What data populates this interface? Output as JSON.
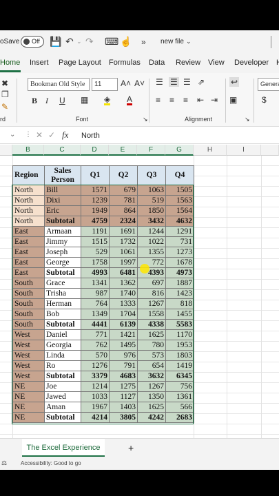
{
  "titlebar": {
    "autosave": "oSave",
    "toggle": "Off",
    "filename": "new file"
  },
  "tabs": [
    "Home",
    "Insert",
    "Page Layout",
    "Formulas",
    "Data",
    "Review",
    "View",
    "Developer",
    "H"
  ],
  "ribbon": {
    "font_name": "Bookman Old Style",
    "font_size": "11",
    "number_format": "General",
    "group_font": "Font",
    "group_alignment": "Alignment",
    "group_clip": "rd",
    "dollar": "$"
  },
  "formula": {
    "cell_value": "North"
  },
  "columns": [
    "B",
    "C",
    "D",
    "E",
    "F",
    "G",
    "H",
    "I"
  ],
  "table": {
    "headers": [
      "Region",
      "Sales Person",
      "Q1",
      "Q2",
      "Q3",
      "Q4"
    ],
    "rows": [
      [
        "North",
        "Bill",
        "1571",
        "679",
        "1063",
        "1505"
      ],
      [
        "North",
        "Dixi",
        "1239",
        "781",
        "519",
        "1563"
      ],
      [
        "North",
        "Eric",
        "1949",
        "864",
        "1850",
        "1564"
      ],
      [
        "North",
        "Subtotal",
        "4759",
        "2324",
        "3432",
        "4632"
      ],
      [
        "East",
        "Armaan",
        "1191",
        "1691",
        "1244",
        "1291"
      ],
      [
        "East",
        "Jimmy",
        "1515",
        "1732",
        "1022",
        "731"
      ],
      [
        "East",
        "Joseph",
        "529",
        "1061",
        "1355",
        "1273"
      ],
      [
        "East",
        "George",
        "1758",
        "1997",
        "772",
        "1678"
      ],
      [
        "East",
        "Subtotal",
        "4993",
        "6481",
        "4393",
        "4973"
      ],
      [
        "South",
        "Grace",
        "1341",
        "1362",
        "697",
        "1887"
      ],
      [
        "South",
        "Trisha",
        "987",
        "1740",
        "816",
        "1423"
      ],
      [
        "South",
        "Herman",
        "764",
        "1333",
        "1267",
        "818"
      ],
      [
        "South",
        "Bob",
        "1349",
        "1704",
        "1558",
        "1455"
      ],
      [
        "South",
        "Subtotal",
        "4441",
        "6139",
        "4338",
        "5583"
      ],
      [
        "West",
        "Daniel",
        "771",
        "1421",
        "1625",
        "1170"
      ],
      [
        "West",
        "Georgia",
        "762",
        "1495",
        "780",
        "1953"
      ],
      [
        "West",
        "Linda",
        "570",
        "976",
        "573",
        "1803"
      ],
      [
        "West",
        "Ro",
        "1276",
        "791",
        "654",
        "1419"
      ],
      [
        "West",
        "Subtotal",
        "3379",
        "4683",
        "3632",
        "6345"
      ],
      [
        "NE",
        "Joe",
        "1214",
        "1275",
        "1267",
        "756"
      ],
      [
        "NE",
        "Jawed",
        "1033",
        "1127",
        "1350",
        "1361"
      ],
      [
        "NE",
        "Aman",
        "1967",
        "1403",
        "1625",
        "566"
      ],
      [
        "NE",
        "Subtotal",
        "4214",
        "3805",
        "4242",
        "2683"
      ]
    ]
  },
  "sheet": {
    "tab_name": "The Excel Experience",
    "add": "+"
  },
  "status": {
    "accessibility": "Accessibility: Good to go"
  }
}
